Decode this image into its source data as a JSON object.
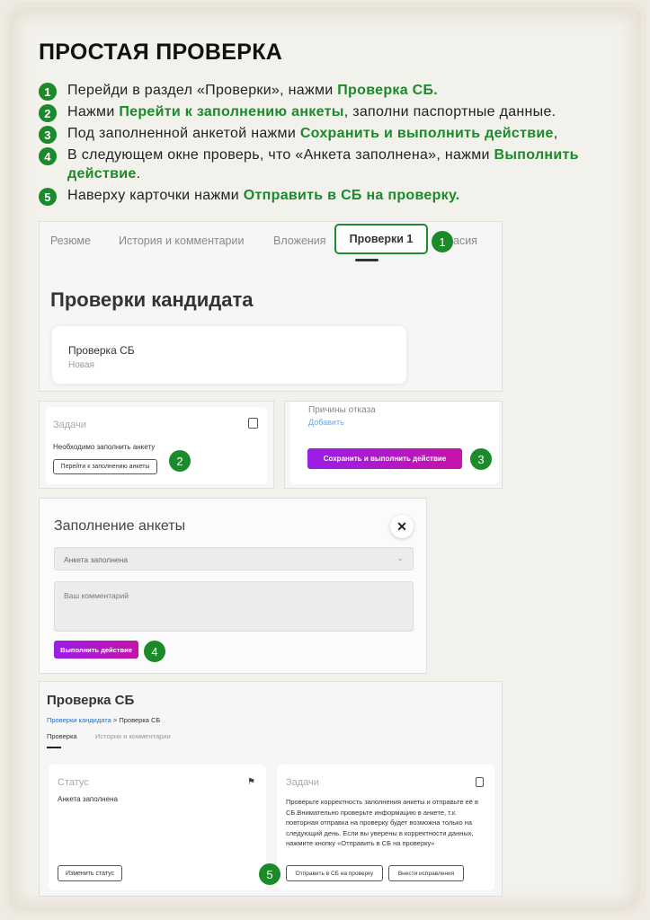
{
  "title": "ПРОСТАЯ ПРОВЕРКА",
  "steps": [
    {
      "num": "1",
      "pre": "Перейди в раздел «Проверки», нажми ",
      "hl": "Проверка СБ.",
      "post": ""
    },
    {
      "num": "2",
      "pre": "Нажми ",
      "hl": "Перейти к заполнению анкеты",
      "post": ", заполни паспортные данные."
    },
    {
      "num": "3",
      "pre": "Под заполненной анкетой нажми ",
      "hl": "Сохранить и выполнить действие",
      "post": ","
    },
    {
      "num": "4",
      "pre": "В следующем окне проверь, что «Анкета заполнена», нажми ",
      "hl": "Выполнить действие",
      "post": "."
    },
    {
      "num": "5",
      "pre": "Наверху карточки нажми ",
      "hl": "Отправить в СБ на проверку.",
      "post": ""
    }
  ],
  "panel1": {
    "tabs": [
      "Резюме",
      "История и комментарии",
      "Вложения",
      "асия"
    ],
    "active_tab": "Проверки 1",
    "heading": "Проверки кандидата",
    "card_title": "Проверка СБ",
    "card_status": "Новая",
    "badge": "1"
  },
  "panel2": {
    "heading": "Задачи",
    "text": "Необходимо заполнить анкету",
    "button": "Перейти к заполнению анкеты",
    "badge": "2"
  },
  "panel3": {
    "heading": "Причины отказа",
    "add_link": "Добавить",
    "button": "Сохранить и выполнить действие",
    "badge": "3"
  },
  "panel4": {
    "heading": "Заполнение анкеты",
    "close": "✕",
    "select_value": "Анкета заполнена",
    "comment_placeholder": "Ваш комментарий",
    "button": "Выполнить действие",
    "badge": "4"
  },
  "panel5": {
    "heading": "Проверка СБ",
    "breadcrumb_link": "Проверки кандидата",
    "breadcrumb_sep": ">",
    "breadcrumb_current": "Проверка СБ",
    "tab_active": "Проверка",
    "tab_other": "История и комментарии",
    "status_heading": "Статус",
    "status_value": "Анкета заполнена",
    "status_button": "Изменить статус",
    "tasks_heading": "Задачи",
    "tasks_text": "Проверьте корректность заполнения анкеты и отправьте её в СБ.Внимательно проверьте информацию в анкете, т.к. повторная отправка на проверку будет возможна только на следующий день. Если вы уверены в корректности данных, нажмите кнопку «Отправить в СБ на проверку»",
    "send_button": "Отправить в СБ на проверку",
    "fix_button": "Внести исправления",
    "badge": "5"
  },
  "colors": {
    "accent_green": "#1a8a2a",
    "button_purple": "#9b1ee8",
    "button_magenta": "#c613a8"
  }
}
